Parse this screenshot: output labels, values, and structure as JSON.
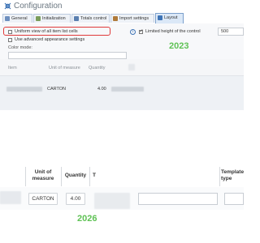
{
  "window": {
    "title": "Configuration",
    "icon": "wrench-gear-icon"
  },
  "tabs": [
    {
      "label": "General",
      "icon": "general-icon",
      "color": "#6d8fbf"
    },
    {
      "label": "Initialization",
      "icon": "initialization-icon",
      "color": "#7a9d5a"
    },
    {
      "label": "Totals control",
      "icon": "totals-icon",
      "color": "#5a7fb0"
    },
    {
      "label": "Import settings",
      "icon": "import-icon",
      "color": "#b07a3a"
    },
    {
      "label": "Layout",
      "icon": "layout-icon",
      "color": "#3e74b6",
      "active": true
    }
  ],
  "layout_tab": {
    "uniform_view_label": "Uniform view of all item list cells",
    "uniform_view_checked": false,
    "advanced_appearance_label": "Use advanced appearance settings",
    "advanced_appearance_checked": false,
    "color_mode_label": "Color mode:",
    "limited_height_label": "Limited height of the control",
    "limited_height_checked": true,
    "height_value": "500"
  },
  "before_label": "2023",
  "after_label": "2026",
  "top_grid": {
    "headers": [
      "Item",
      "Unit of measure",
      "Quantity"
    ],
    "row": {
      "unit": "CARTON",
      "quantity": "4.00"
    }
  },
  "bottom_grid": {
    "headers": [
      "Unit of measure",
      "Quantity",
      "T",
      "Template type"
    ],
    "row": {
      "unit": "CARTON",
      "quantity": "4.00"
    }
  },
  "colors": {
    "accent": "#3e74b6",
    "highlight_border": "#e03a3a",
    "year_green": "#5fc255"
  }
}
